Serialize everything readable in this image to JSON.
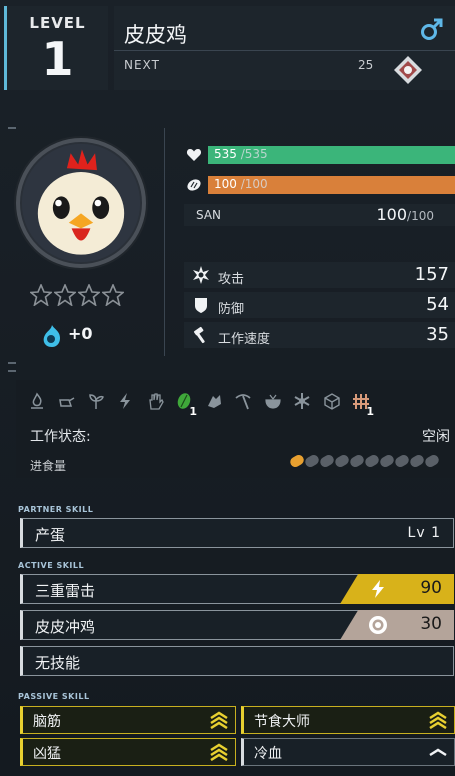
{
  "header": {
    "level_label": "LEVEL",
    "level_value": "1",
    "pal_name": "皮皮鸡",
    "gender": "male",
    "next_label": "NEXT",
    "next_value": "25"
  },
  "portrait": {
    "rank_stars": 4,
    "filled_stars": 0,
    "soul_bonus": "+0"
  },
  "stats": {
    "hp": {
      "value": "535",
      "max": "/535",
      "fill_fraction": 1.0,
      "color": "#3bb57a"
    },
    "food": {
      "value": "100",
      "max": "/100",
      "fill_fraction": 1.0,
      "color": "#d9803a"
    },
    "san": {
      "label": "SAN",
      "value": "100",
      "max": "/100"
    },
    "attack": {
      "label": "攻击",
      "value": "157"
    },
    "defense": {
      "label": "防御",
      "value": "54"
    },
    "work_speed": {
      "label": "工作速度",
      "value": "35"
    }
  },
  "work": {
    "icons": [
      "kindling-icon",
      "watering-icon",
      "planting-icon",
      "electricity-icon",
      "handiwork-icon",
      "gathering-icon",
      "lumbering-icon",
      "mining-icon",
      "medicine-icon",
      "cooling-icon",
      "transporting-icon",
      "farming-icon"
    ],
    "active_icons": {
      "gathering-icon": "1",
      "farming-icon": "1"
    },
    "status_label": "工作状态:",
    "status_value": "空闲",
    "food_label": "进食量",
    "food_pips_total": 10,
    "food_pips_filled": 1
  },
  "skills": {
    "partner_title": "PARTNER SKILL",
    "partner": {
      "name": "产蛋",
      "level": "Lv 1"
    },
    "active_title": "ACTIVE SKILL",
    "active": [
      {
        "name": "三重雷击",
        "element": "electric",
        "element_color": "#d8b21a",
        "value": "90"
      },
      {
        "name": "皮皮冲鸡",
        "element": "neutral",
        "element_color": "#b4a49a",
        "value": "30"
      },
      {
        "name": "无技能"
      }
    ],
    "passive_title": "PASSIVE SKILL",
    "passive": [
      {
        "name": "脑筋",
        "rank": "gold"
      },
      {
        "name": "节食大师",
        "rank": "gold"
      },
      {
        "name": "凶猛",
        "rank": "gold"
      },
      {
        "name": "冷血",
        "rank": "plain"
      }
    ]
  }
}
